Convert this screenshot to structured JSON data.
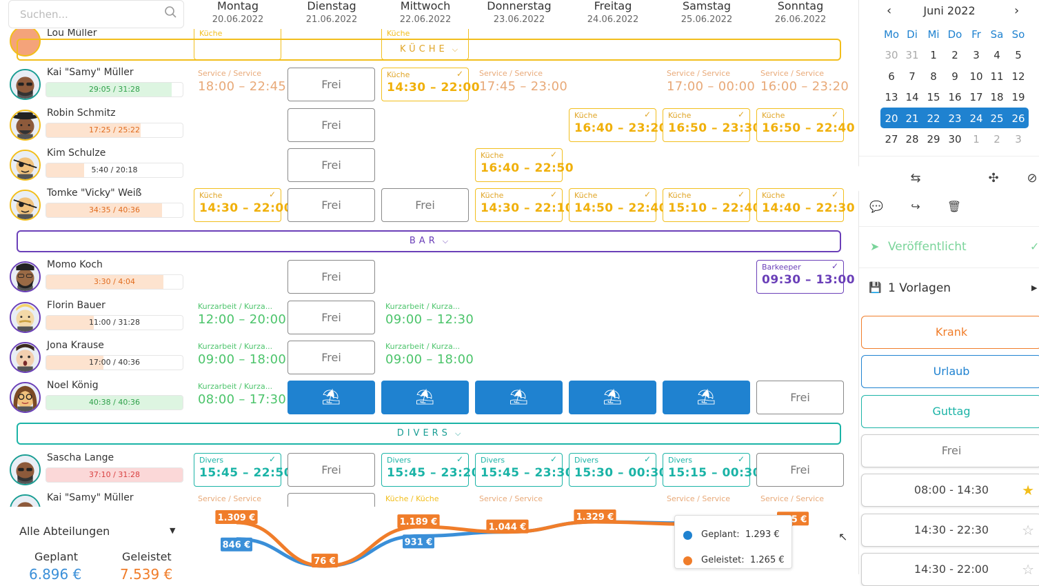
{
  "search": {
    "placeholder": "Suchen..."
  },
  "days": [
    {
      "name": "Montag",
      "date": "20.06.2022"
    },
    {
      "name": "Dienstag",
      "date": "21.06.2022"
    },
    {
      "name": "Mittwoch",
      "date": "22.06.2022"
    },
    {
      "name": "Donnerstag",
      "date": "23.06.2022"
    },
    {
      "name": "Freitag",
      "date": "24.06.2022"
    },
    {
      "name": "Samstag",
      "date": "25.06.2022"
    },
    {
      "name": "Sonntag",
      "date": "26.06.2022"
    }
  ],
  "partial_top": {
    "name": "Lou Müller",
    "labels": [
      "Küche",
      "Küche"
    ]
  },
  "groups": [
    {
      "label": "KÜCHE",
      "color": "#f2be1b",
      "text_color": "#e0a526"
    },
    {
      "label": "BAR",
      "color": "#6a3fb8",
      "text_color": "#6a3fb8"
    },
    {
      "label": "DIVERS",
      "color": "#1ab3a6",
      "text_color": "#1a9e94"
    }
  ],
  "employees": [
    {
      "name": "Kai \"Samy\" Müller",
      "hours": "29:05 / 31:28",
      "fill": 0.92,
      "tone": "green",
      "ring": "#1a9e94",
      "avatar": "sunglasses-man",
      "cells": [
        {
          "type": "plain",
          "label": "Service / Service",
          "time": "18:00 – 22:45",
          "color": "#e8a978"
        },
        {
          "type": "frei",
          "label": "Frei"
        },
        {
          "type": "card",
          "label": "Küche",
          "time": "14:30 – 22:00",
          "color": "#f2be1b",
          "check": "✓"
        },
        {
          "type": "plain",
          "label": "Service / Service",
          "time": "17:45 – 23:00",
          "color": "#e8a978"
        },
        {
          "type": "empty"
        },
        {
          "type": "plain",
          "label": "Service / Service",
          "time": "17:00 – 00:00",
          "color": "#e8a978"
        },
        {
          "type": "plain",
          "label": "Service / Service",
          "time": "16:00 – 23:20",
          "color": "#e8a978"
        }
      ]
    },
    {
      "name": "Robin Schmitz",
      "hours": "17:25 / 25:22",
      "fill": 0.69,
      "tone": "orange",
      "ring": "#f2be1b",
      "avatar": "hat-man",
      "cells": [
        {
          "type": "empty"
        },
        {
          "type": "frei",
          "label": "Frei"
        },
        {
          "type": "empty"
        },
        {
          "type": "empty"
        },
        {
          "type": "card",
          "label": "Küche",
          "time": "16:40 – 23:20",
          "color": "#f2be1b",
          "check": "✓"
        },
        {
          "type": "card",
          "label": "Küche",
          "time": "16:50 – 23:30",
          "color": "#f2be1b",
          "check": "✓"
        },
        {
          "type": "card",
          "label": "Küche",
          "time": "16:50 – 22:40",
          "color": "#f2be1b",
          "check": "✓"
        }
      ]
    },
    {
      "name": "Kim Schulze",
      "hours": "5:40 / 20:18",
      "fill": 0.28,
      "tone": "orange",
      "ring": "#f2be1b",
      "avatar": "eyepatch",
      "cells": [
        {
          "type": "empty"
        },
        {
          "type": "frei",
          "label": "Frei"
        },
        {
          "type": "empty"
        },
        {
          "type": "card",
          "label": "Küche",
          "time": "16:40 – 22:50",
          "color": "#f2be1b",
          "check": "✓"
        },
        {
          "type": "empty"
        },
        {
          "type": "empty"
        },
        {
          "type": "empty"
        }
      ]
    },
    {
      "name": "Tomke \"Vicky\" Weiß",
      "hours": "34:35 / 40:36",
      "fill": 0.85,
      "tone": "orange",
      "ring": "#f2be1b",
      "avatar": "eyepatch",
      "cells": [
        {
          "type": "card",
          "label": "Küche",
          "time": "14:30 – 22:00",
          "color": "#f2be1b",
          "check": "✓"
        },
        {
          "type": "frei",
          "label": "Frei"
        },
        {
          "type": "frei",
          "label": "Frei"
        },
        {
          "type": "card",
          "label": "Küche",
          "time": "14:30 – 22:10",
          "color": "#f2be1b",
          "check": "✓"
        },
        {
          "type": "card",
          "label": "Küche",
          "time": "14:50 – 22:40",
          "color": "#f2be1b",
          "check": "✓"
        },
        {
          "type": "card",
          "label": "Küche",
          "time": "15:10 – 22:40",
          "color": "#f2be1b",
          "check": "✓"
        },
        {
          "type": "card",
          "label": "Küche",
          "time": "14:40 – 22:30",
          "color": "#f2be1b",
          "check": "✓"
        }
      ]
    },
    {
      "name": "Momo Koch",
      "hours": "3:30 / 4:04",
      "fill": 0.86,
      "tone": "orange",
      "ring": "#6a3fb8",
      "avatar": "beard-man",
      "cells": [
        {
          "type": "empty"
        },
        {
          "type": "frei",
          "label": "Frei"
        },
        {
          "type": "empty"
        },
        {
          "type": "empty"
        },
        {
          "type": "empty"
        },
        {
          "type": "empty"
        },
        {
          "type": "card",
          "label": "Barkeeper",
          "time": "09:30 – 13:00",
          "color": "#6a3fb8",
          "check": "✓"
        }
      ]
    },
    {
      "name": "Florin Bauer",
      "hours": "11:00 / 31:28",
      "fill": 0.35,
      "tone": "orange",
      "ring": "#6a3fb8",
      "avatar": "blond-man",
      "cells": [
        {
          "type": "plain",
          "label": "Kurzarbeit / Kurza...",
          "time": "12:00 – 20:00",
          "color": "#4cc46b"
        },
        {
          "type": "frei",
          "label": "Frei"
        },
        {
          "type": "plain",
          "label": "Kurzarbeit / Kurza...",
          "time": "09:00 – 12:30",
          "color": "#4cc46b"
        },
        {
          "type": "empty"
        },
        {
          "type": "empty"
        },
        {
          "type": "empty"
        },
        {
          "type": "empty"
        }
      ]
    },
    {
      "name": "Jona Krause",
      "hours": "17:00 / 40:36",
      "fill": 0.42,
      "tone": "orange",
      "ring": "#6a3fb8",
      "avatar": "surprised",
      "cells": [
        {
          "type": "plain",
          "label": "Kurzarbeit / Kurza...",
          "time": "09:00 – 18:00",
          "color": "#4cc46b"
        },
        {
          "type": "frei",
          "label": "Frei"
        },
        {
          "type": "plain",
          "label": "Kurzarbeit / Kurza...",
          "time": "09:00 – 18:00",
          "color": "#4cc46b"
        },
        {
          "type": "empty"
        },
        {
          "type": "empty"
        },
        {
          "type": "empty"
        },
        {
          "type": "empty"
        }
      ]
    },
    {
      "name": "Noel König",
      "hours": "40:38 / 40:36",
      "fill": 1.0,
      "tone": "green",
      "ring": "#6a3fb8",
      "avatar": "glasses-woman",
      "cells": [
        {
          "type": "plain",
          "label": "Kurzarbeit / Kurza...",
          "time": "08:00 – 17:30",
          "color": "#4cc46b"
        },
        {
          "type": "vacation",
          "icon": "⛱"
        },
        {
          "type": "vacation",
          "icon": "⛱"
        },
        {
          "type": "vacation",
          "icon": "⛱"
        },
        {
          "type": "vacation",
          "icon": "⛱"
        },
        {
          "type": "vacation",
          "icon": "⛱"
        },
        {
          "type": "frei",
          "label": "Frei"
        }
      ]
    },
    {
      "name": "Sascha Lange",
      "hours": "37:10 / 31:28",
      "fill": 1.0,
      "tone": "red",
      "ring": "#1a9e94",
      "avatar": "sunglasses-man",
      "cells": [
        {
          "type": "card",
          "label": "Divers",
          "time": "15:45 – 22:50",
          "color": "#1ab3a6",
          "check": "✓"
        },
        {
          "type": "frei",
          "label": "Frei"
        },
        {
          "type": "card",
          "label": "Divers",
          "time": "15:45 – 23:20",
          "color": "#1ab3a6",
          "check": "✓"
        },
        {
          "type": "card",
          "label": "Divers",
          "time": "15:45 – 23:30",
          "color": "#1ab3a6",
          "check": "✓"
        },
        {
          "type": "card",
          "label": "Divers",
          "time": "15:30 – 00:30",
          "color": "#1ab3a6",
          "check": "✓"
        },
        {
          "type": "card",
          "label": "Divers",
          "time": "15:15 – 00:30",
          "color": "#1ab3a6",
          "check": "✓"
        },
        {
          "type": "frei",
          "label": "Frei"
        }
      ]
    },
    {
      "name": "Kai \"Samy\" Müller",
      "hours": "",
      "fill": 0,
      "tone": "green",
      "ring": "#1a9e94",
      "avatar": "sunglasses-man",
      "cells": [
        {
          "type": "plain",
          "label": "Service / Service",
          "time": "",
          "color": "#e8a978"
        },
        {
          "type": "frei",
          "label": ""
        },
        {
          "type": "plain",
          "label": "Küche / Küche",
          "time": "",
          "color": "#f2be1b"
        },
        {
          "type": "plain",
          "label": "Service / Service",
          "time": "",
          "color": "#e8a978"
        },
        {
          "type": "empty"
        },
        {
          "type": "plain",
          "label": "Service / Service",
          "time": "",
          "color": "#e8a978"
        },
        {
          "type": "plain",
          "label": "Service / Service",
          "time": "",
          "color": "#e8a978"
        }
      ]
    }
  ],
  "summary": {
    "department": "Alle Abteilungen",
    "planned_label": "Geplant",
    "planned_value": "6.896 €",
    "done_label": "Geleistet",
    "done_value": "7.539 €",
    "planned_color": "#3a8fd8",
    "done_color": "#f07d2a"
  },
  "chart_data": {
    "type": "line",
    "categories": [
      "Montag",
      "Dienstag",
      "Mittwoch",
      "Donnerstag",
      "Freitag",
      "Samstag",
      "Sonntag"
    ],
    "series": [
      {
        "name": "Geplant",
        "values": [
          846,
          76,
          931,
          1044,
          1329,
          1293,
          1265
        ],
        "labels": [
          "846 €",
          "",
          "931 €",
          "",
          "",
          "",
          ""
        ]
      },
      {
        "name": "Geleistet",
        "values": [
          1309,
          76,
          1189,
          1044,
          1329,
          1265,
          1265
        ],
        "labels": [
          "1.309 €",
          "76 €",
          "1.189 €",
          "1.044 €",
          "1.329 €",
          "",
          "265 €"
        ]
      }
    ],
    "tooltip": {
      "planned_label": "Geplant:",
      "planned_value": "1.293 €",
      "done_label": "Geleistet:",
      "done_value": "1.265 €"
    }
  },
  "calendar": {
    "month": "Juni 2022",
    "prev": "‹",
    "next": "›",
    "dow": [
      "Mo",
      "Di",
      "Mi",
      "Do",
      "Fr",
      "Sa",
      "So"
    ],
    "weeks": [
      [
        "30",
        "31",
        "1",
        "2",
        "3",
        "4",
        "5"
      ],
      [
        "6",
        "7",
        "8",
        "9",
        "10",
        "11",
        "12"
      ],
      [
        "13",
        "14",
        "15",
        "16",
        "17",
        "18",
        "19"
      ],
      [
        "20",
        "21",
        "22",
        "23",
        "24",
        "25",
        "26"
      ],
      [
        "27",
        "28",
        "29",
        "30",
        "1",
        "2",
        "3"
      ]
    ]
  },
  "tools": [
    {
      "name": "chart-icon",
      "glyph": "📈",
      "state": "on"
    },
    {
      "name": "toggle-icon",
      "glyph": "⇆",
      "state": "off"
    },
    {
      "name": "copy-icon",
      "glyph": "❐",
      "state": "on"
    },
    {
      "name": "compress-icon",
      "glyph": "✣",
      "state": "off"
    },
    {
      "name": "user-off-icon",
      "glyph": "⊘",
      "state": "off"
    }
  ],
  "tools2": [
    {
      "name": "comment-icon",
      "glyph": "💬"
    },
    {
      "name": "share-icon",
      "glyph": "↪"
    },
    {
      "name": "trash-icon",
      "glyph": "🗑"
    }
  ],
  "publish": {
    "label": "Veröffentlicht",
    "check": "✓",
    "icon": "➤"
  },
  "templates": {
    "label": "1 Vorlagen",
    "icon": "💾",
    "arrow": "▶"
  },
  "status_buttons": [
    {
      "label": "Krank",
      "color": "#f07d2a",
      "text": "#f07d2a"
    },
    {
      "label": "Urlaub",
      "color": "#1f82d0",
      "text": "#1f82d0"
    },
    {
      "label": "Guttag",
      "color": "#1ab3a6",
      "text": "#1ab3a6"
    },
    {
      "label": "Frei",
      "color": "#999",
      "text": "#777"
    },
    {
      "label": "08:00 - 14:30",
      "color": "#555",
      "text": "#444",
      "star": "★",
      "starcolor": "#f2be1b"
    },
    {
      "label": "14:30 - 22:30",
      "color": "#555",
      "text": "#444",
      "star": "☆",
      "starcolor": "#bbb"
    },
    {
      "label": "14:30 - 22:00",
      "color": "#555",
      "text": "#444",
      "star": "☆",
      "starcolor": "#bbb"
    }
  ]
}
